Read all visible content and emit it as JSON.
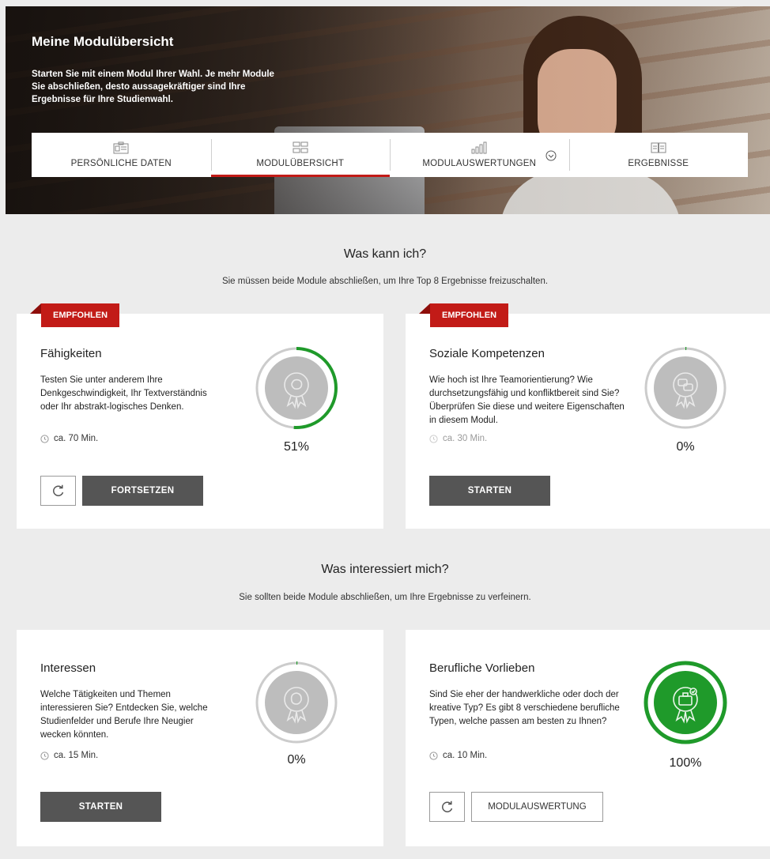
{
  "header": {
    "title": "Meine Modulübersicht",
    "intro": "Starten Sie mit einem Modul Ihrer Wahl. Je mehr Module Sie abschließen, desto aussagekräftiger sind Ihre Ergebnisse für Ihre Studienwahl."
  },
  "tabs": [
    {
      "label": "PERSÖNLICHE DATEN",
      "icon": "id-card-icon"
    },
    {
      "label": "MODULÜBERSICHT",
      "icon": "modules-grid-icon",
      "active": true
    },
    {
      "label": "MODULAUSWERTUNGEN",
      "icon": "bar-chart-icon"
    },
    {
      "label": "ERGEBNISSE",
      "icon": "open-book-icon"
    }
  ],
  "sections": [
    {
      "title": "Was kann ich?",
      "subtitle": "Sie müssen beide Module abschließen, um Ihre Top 8 Ergebnisse freizuschalten.",
      "cards": [
        {
          "badge": "EMPFOHLEN",
          "title": "Fähigkeiten",
          "description": "Testen Sie unter anderem Ihre Denkgeschwindigkeit, Ihr Textverständnis oder Ihr abstrakt-logisches Denken.",
          "time": "ca. 70 Min.",
          "progress": 51,
          "progress_label": "51%",
          "primary_button": "FORTSETZEN"
        },
        {
          "badge": "EMPFOHLEN",
          "title": "Soziale Kompetenzen",
          "description": "Wie hoch ist Ihre Teamorientierung? Wie durchsetzungsfähig und konfliktbereit sind Sie? Überprüfen Sie diese und weitere Eigenschaften in diesem Modul.",
          "time": "ca. 30 Min.",
          "progress": 0,
          "progress_label": "0%",
          "primary_button": "STARTEN"
        }
      ]
    },
    {
      "title": "Was interessiert mich?",
      "subtitle": "Sie sollten beide Module abschließen, um Ihre Ergebnisse zu verfeinern.",
      "cards": [
        {
          "title": "Interessen",
          "description": "Welche Tätigkeiten und Themen interessieren Sie? Entdecken Sie, welche Studienfelder und Berufe Ihre Neugier wecken könnten.",
          "time": "ca. 15 Min.",
          "progress": 0,
          "progress_label": "0%",
          "primary_button": "STARTEN"
        },
        {
          "title": "Berufliche Vorlieben",
          "description": "Sind Sie eher der handwerkliche oder doch der kreative Typ? Es gibt 8 verschiedene berufliche Typen, welche passen am besten zu Ihnen?",
          "time": "ca. 10 Min.",
          "progress": 100,
          "progress_label": "100%",
          "secondary_button": "MODULAUSWERTUNG"
        }
      ]
    }
  ],
  "colors": {
    "accent_red": "#c21b17",
    "progress_green": "#1f9a2a",
    "ring_gray": "#c8c8c8",
    "button_dark": "#555555"
  }
}
